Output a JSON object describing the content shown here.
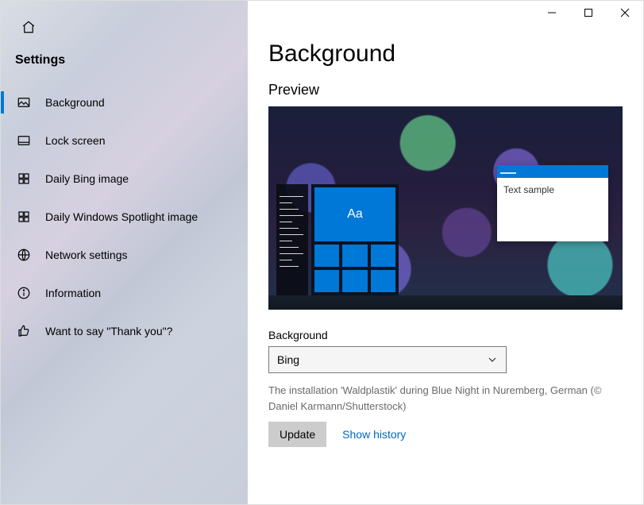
{
  "app": {
    "home_icon": "home-icon",
    "title": "Settings"
  },
  "sidebar": {
    "items": [
      {
        "icon": "image-icon",
        "label": "Background",
        "active": true
      },
      {
        "icon": "lockscreen-icon",
        "label": "Lock screen"
      },
      {
        "icon": "grid-icon",
        "label": "Daily Bing image"
      },
      {
        "icon": "grid-icon",
        "label": "Daily Windows Spotlight image"
      },
      {
        "icon": "globe-icon",
        "label": "Network settings"
      },
      {
        "icon": "info-icon",
        "label": "Information"
      },
      {
        "icon": "thumbs-up-icon",
        "label": "Want to say \"Thank you\"?"
      }
    ]
  },
  "titlebar": {
    "minimize": "minimize",
    "maximize": "maximize",
    "close": "close"
  },
  "page": {
    "title": "Background",
    "preview_heading": "Preview",
    "preview": {
      "tile_text": "Aa",
      "sample_text": "Text sample"
    },
    "background_label": "Background",
    "background_select": {
      "value": "Bing"
    },
    "caption": "The installation 'Waldplastik' during Blue Night in Nuremberg, German (© Daniel Karmann/Shutterstock)",
    "update_button": "Update",
    "show_history_link": "Show history"
  }
}
